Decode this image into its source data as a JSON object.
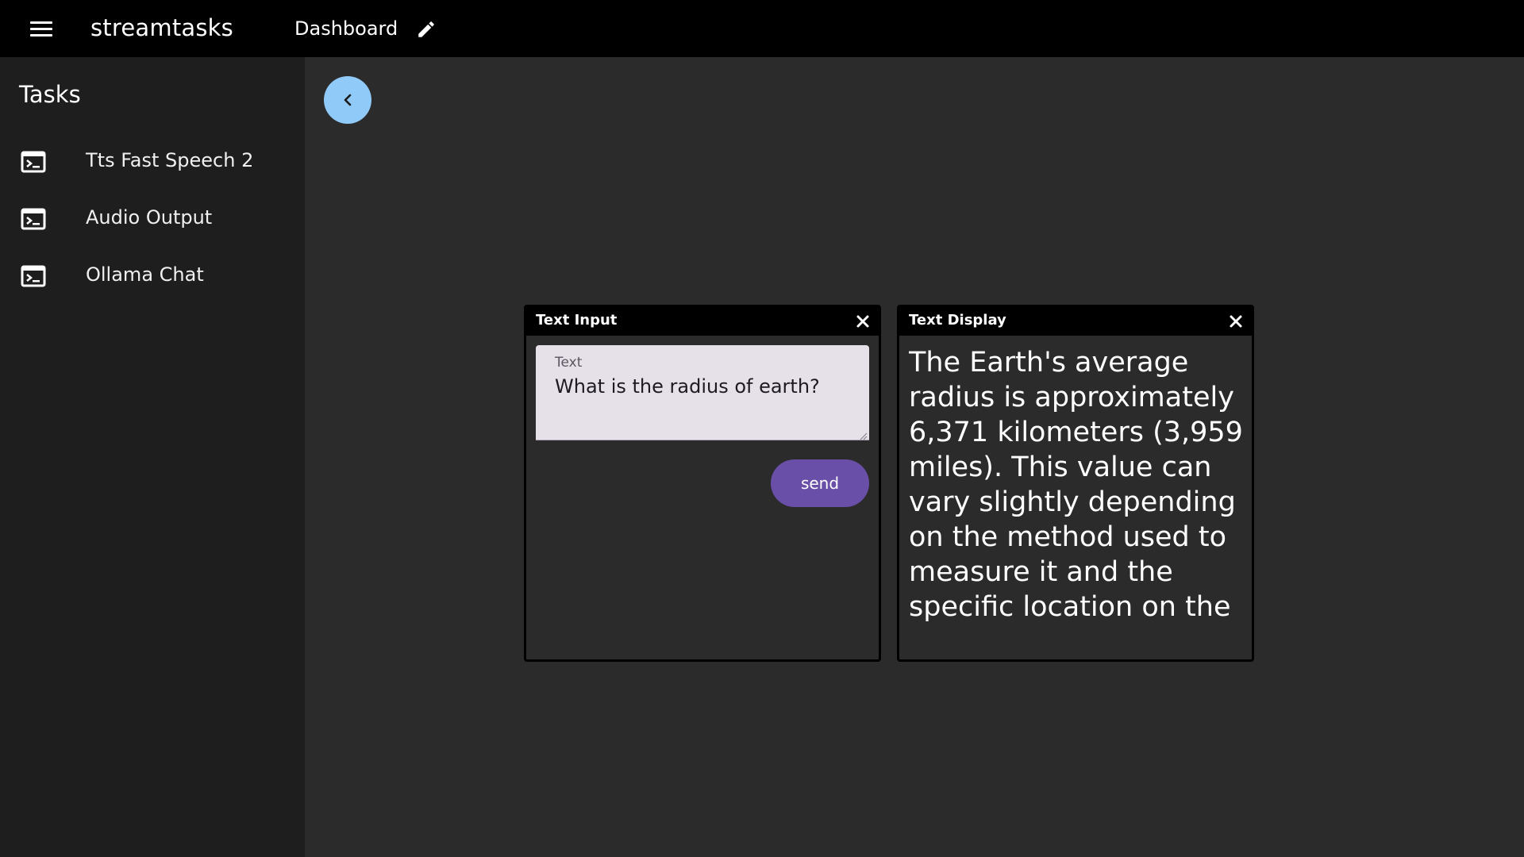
{
  "appbar": {
    "title": "streamtasks",
    "dashboard_label": "Dashboard",
    "menu_icon": "hamburger-menu-icon",
    "edit_icon": "pencil-icon"
  },
  "sidebar": {
    "title": "Tasks",
    "items": [
      {
        "label": "Tts Fast Speech 2",
        "icon": "terminal-icon"
      },
      {
        "label": "Audio Output",
        "icon": "terminal-icon"
      },
      {
        "label": "Ollama Chat",
        "icon": "terminal-icon"
      }
    ]
  },
  "collapse_button": {
    "icon": "chevron-left-icon",
    "color": "#90caf9"
  },
  "widgets": {
    "text_input": {
      "title": "Text Input",
      "field_label": "Text",
      "field_value": "What is the radius of earth?",
      "send_label": "send",
      "send_color": "#6a4fa8"
    },
    "text_display": {
      "title": "Text Display",
      "content": "The Earth's average radius is approximately 6,371 kilometers (3,959 miles). This value can vary slightly depending on the method used to measure it and the specific location on the"
    }
  },
  "colors": {
    "appbar": "#000000",
    "sidebar": "#1e1e1e",
    "workspace": "#2b2b2b",
    "textarea_bg": "#e6e0e9"
  }
}
